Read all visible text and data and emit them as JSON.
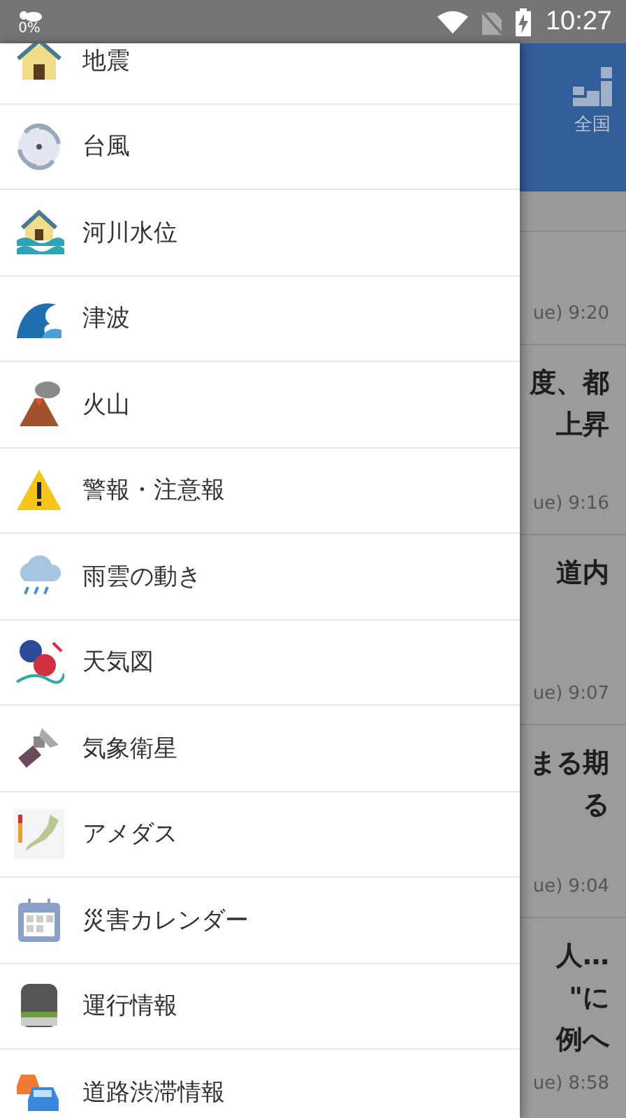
{
  "status_bar": {
    "weather_percent": "0%",
    "time": "10:27"
  },
  "drawer": {
    "items": [
      {
        "label": "地震"
      },
      {
        "label": "台風"
      },
      {
        "label": "河川水位"
      },
      {
        "label": "津波"
      },
      {
        "label": "火山"
      },
      {
        "label": "警報・注意報"
      },
      {
        "label": "雨雲の動き"
      },
      {
        "label": "天気図"
      },
      {
        "label": "気象衛星"
      },
      {
        "label": "アメダス"
      },
      {
        "label": "災害カレンダー"
      },
      {
        "label": "運行情報"
      },
      {
        "label": "道路渋滞情報"
      }
    ]
  },
  "background": {
    "header": {
      "region_label": "全国"
    },
    "news": [
      {
        "time": "ue) 9:20"
      },
      {
        "lines": [
          "度、都",
          "上昇"
        ],
        "time": "ue) 9:16"
      },
      {
        "lines": [
          "道内"
        ],
        "time": "ue) 9:07"
      },
      {
        "lines": [
          "まる期",
          "る"
        ],
        "time": "ue) 9:04"
      },
      {
        "lines": [
          "人…",
          "\"に",
          "例へ"
        ],
        "time": "ue) 8:58"
      }
    ]
  }
}
